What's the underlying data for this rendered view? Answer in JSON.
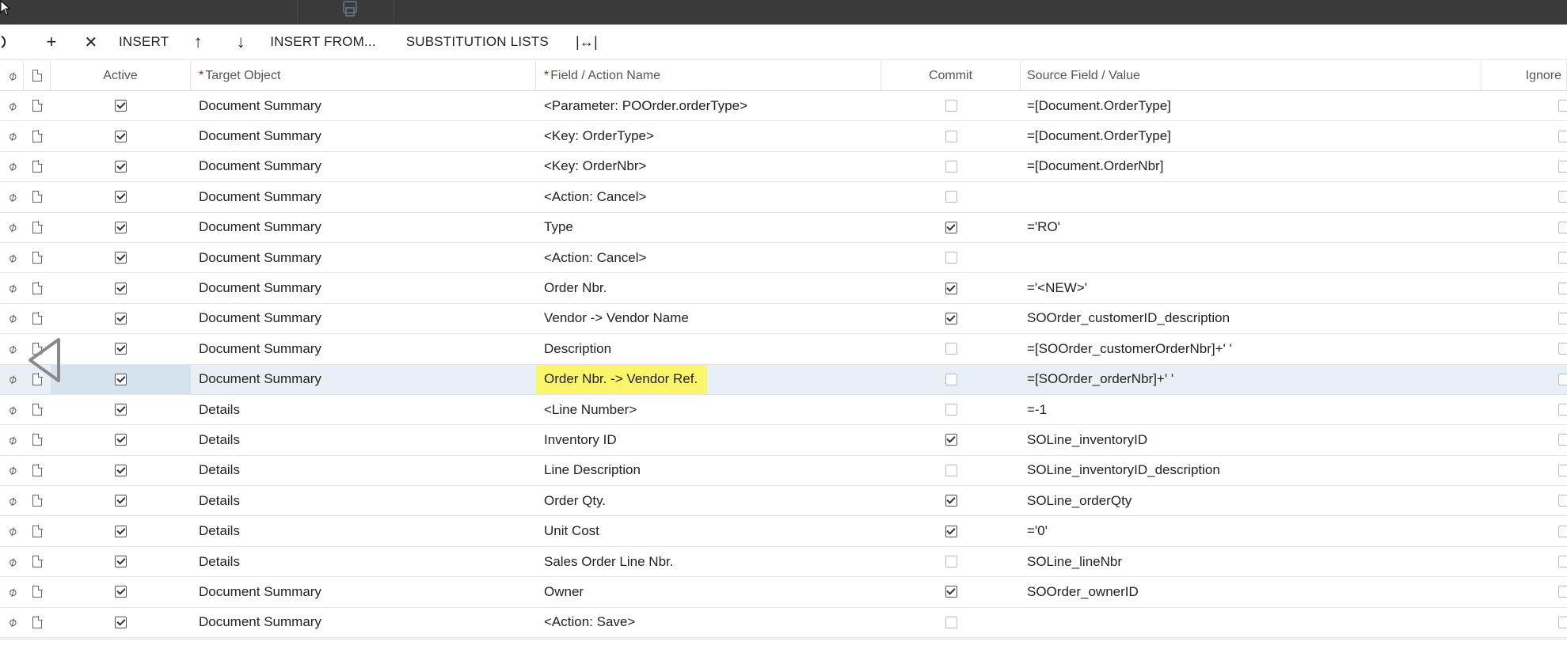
{
  "toolbar": {
    "refresh_icon": "refresh-icon",
    "add_icon": "+",
    "delete_icon": "✕",
    "insert_label": "INSERT",
    "move_up_icon": "↑",
    "move_down_icon": "↓",
    "insert_from_label": "INSERT FROM...",
    "substitution_lists_label": "SUBSTITUTION LISTS",
    "fit_columns_icon": "|↔|"
  },
  "columns": {
    "active": "Active",
    "target_object": "Target Object",
    "field_action_name": "Field / Action Name",
    "commit": "Commit",
    "source_field_value": "Source Field / Value",
    "ignore": "Ignore"
  },
  "rows": [
    {
      "active": true,
      "target": "Document Summary",
      "field": "<Parameter: POOrder.orderType>",
      "commit": false,
      "source": "=[Document.OrderType]"
    },
    {
      "active": true,
      "target": "Document Summary",
      "field": "<Key: OrderType>",
      "commit": false,
      "source": "=[Document.OrderType]"
    },
    {
      "active": true,
      "target": "Document Summary",
      "field": "<Key: OrderNbr>",
      "commit": false,
      "source": "=[Document.OrderNbr]"
    },
    {
      "active": true,
      "target": "Document Summary",
      "field": "<Action: Cancel>",
      "commit": false,
      "source": ""
    },
    {
      "active": true,
      "target": "Document Summary",
      "field": "Type",
      "commit": true,
      "source": "='RO'"
    },
    {
      "active": true,
      "target": "Document Summary",
      "field": "<Action: Cancel>",
      "commit": false,
      "source": ""
    },
    {
      "active": true,
      "target": "Document Summary",
      "field": "Order Nbr.",
      "commit": true,
      "source": "='<NEW>'"
    },
    {
      "active": true,
      "target": "Document Summary",
      "field": "Vendor -> Vendor Name",
      "commit": true,
      "source": "SOOrder_customerID_description"
    },
    {
      "active": true,
      "target": "Document Summary",
      "field": "Description",
      "commit": false,
      "source": "=[SOOrder_customerOrderNbr]+' '"
    },
    {
      "active": true,
      "target": "Document Summary",
      "field": "Order Nbr. -> Vendor Ref.",
      "commit": false,
      "source": "=[SOOrder_orderNbr]+' '",
      "selected": true
    },
    {
      "active": true,
      "target": "Details",
      "field": "<Line Number>",
      "commit": false,
      "source": "=-1"
    },
    {
      "active": true,
      "target": "Details",
      "field": "Inventory ID",
      "commit": true,
      "source": "SOLine_inventoryID"
    },
    {
      "active": true,
      "target": "Details",
      "field": "Line Description",
      "commit": false,
      "source": "SOLine_inventoryID_description"
    },
    {
      "active": true,
      "target": "Details",
      "field": "Order Qty.",
      "commit": true,
      "source": "SOLine_orderQty"
    },
    {
      "active": true,
      "target": "Details",
      "field": "Unit Cost",
      "commit": true,
      "source": "='0'"
    },
    {
      "active": true,
      "target": "Details",
      "field": "Sales Order Line Nbr.",
      "commit": false,
      "source": "SOLine_lineNbr"
    },
    {
      "active": true,
      "target": "Document Summary",
      "field": "Owner",
      "commit": true,
      "source": "SOOrder_ownerID"
    },
    {
      "active": true,
      "target": "Document Summary",
      "field": "<Action: Save>",
      "commit": false,
      "source": ""
    }
  ],
  "colors": {
    "highlight": "#fbf56b",
    "selected_row": "#e8f0f6",
    "required_asterisk": "#d0021b",
    "topbar": "#3a3a3a"
  }
}
